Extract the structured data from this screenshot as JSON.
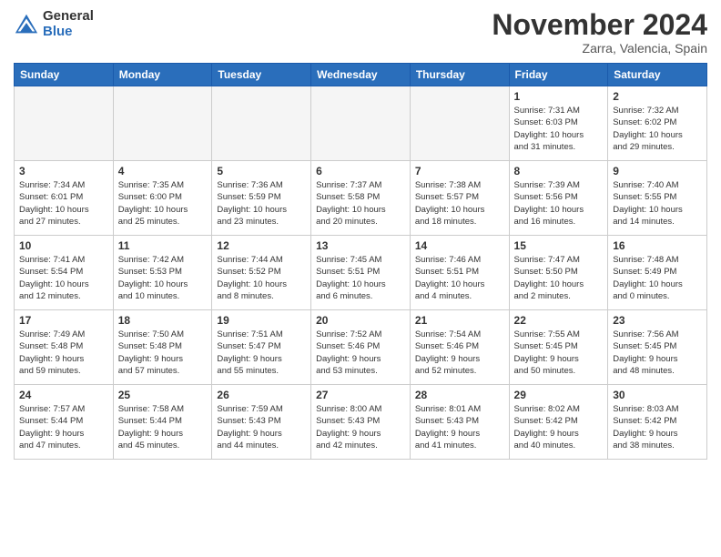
{
  "app": {
    "logo_general": "General",
    "logo_blue": "Blue"
  },
  "header": {
    "month_title": "November 2024",
    "location": "Zarra, Valencia, Spain"
  },
  "weekdays": [
    "Sunday",
    "Monday",
    "Tuesday",
    "Wednesday",
    "Thursday",
    "Friday",
    "Saturday"
  ],
  "weeks": [
    [
      {
        "day": "",
        "info": ""
      },
      {
        "day": "",
        "info": ""
      },
      {
        "day": "",
        "info": ""
      },
      {
        "day": "",
        "info": ""
      },
      {
        "day": "",
        "info": ""
      },
      {
        "day": "1",
        "info": "Sunrise: 7:31 AM\nSunset: 6:03 PM\nDaylight: 10 hours\nand 31 minutes."
      },
      {
        "day": "2",
        "info": "Sunrise: 7:32 AM\nSunset: 6:02 PM\nDaylight: 10 hours\nand 29 minutes."
      }
    ],
    [
      {
        "day": "3",
        "info": "Sunrise: 7:34 AM\nSunset: 6:01 PM\nDaylight: 10 hours\nand 27 minutes."
      },
      {
        "day": "4",
        "info": "Sunrise: 7:35 AM\nSunset: 6:00 PM\nDaylight: 10 hours\nand 25 minutes."
      },
      {
        "day": "5",
        "info": "Sunrise: 7:36 AM\nSunset: 5:59 PM\nDaylight: 10 hours\nand 23 minutes."
      },
      {
        "day": "6",
        "info": "Sunrise: 7:37 AM\nSunset: 5:58 PM\nDaylight: 10 hours\nand 20 minutes."
      },
      {
        "day": "7",
        "info": "Sunrise: 7:38 AM\nSunset: 5:57 PM\nDaylight: 10 hours\nand 18 minutes."
      },
      {
        "day": "8",
        "info": "Sunrise: 7:39 AM\nSunset: 5:56 PM\nDaylight: 10 hours\nand 16 minutes."
      },
      {
        "day": "9",
        "info": "Sunrise: 7:40 AM\nSunset: 5:55 PM\nDaylight: 10 hours\nand 14 minutes."
      }
    ],
    [
      {
        "day": "10",
        "info": "Sunrise: 7:41 AM\nSunset: 5:54 PM\nDaylight: 10 hours\nand 12 minutes."
      },
      {
        "day": "11",
        "info": "Sunrise: 7:42 AM\nSunset: 5:53 PM\nDaylight: 10 hours\nand 10 minutes."
      },
      {
        "day": "12",
        "info": "Sunrise: 7:44 AM\nSunset: 5:52 PM\nDaylight: 10 hours\nand 8 minutes."
      },
      {
        "day": "13",
        "info": "Sunrise: 7:45 AM\nSunset: 5:51 PM\nDaylight: 10 hours\nand 6 minutes."
      },
      {
        "day": "14",
        "info": "Sunrise: 7:46 AM\nSunset: 5:51 PM\nDaylight: 10 hours\nand 4 minutes."
      },
      {
        "day": "15",
        "info": "Sunrise: 7:47 AM\nSunset: 5:50 PM\nDaylight: 10 hours\nand 2 minutes."
      },
      {
        "day": "16",
        "info": "Sunrise: 7:48 AM\nSunset: 5:49 PM\nDaylight: 10 hours\nand 0 minutes."
      }
    ],
    [
      {
        "day": "17",
        "info": "Sunrise: 7:49 AM\nSunset: 5:48 PM\nDaylight: 9 hours\nand 59 minutes."
      },
      {
        "day": "18",
        "info": "Sunrise: 7:50 AM\nSunset: 5:48 PM\nDaylight: 9 hours\nand 57 minutes."
      },
      {
        "day": "19",
        "info": "Sunrise: 7:51 AM\nSunset: 5:47 PM\nDaylight: 9 hours\nand 55 minutes."
      },
      {
        "day": "20",
        "info": "Sunrise: 7:52 AM\nSunset: 5:46 PM\nDaylight: 9 hours\nand 53 minutes."
      },
      {
        "day": "21",
        "info": "Sunrise: 7:54 AM\nSunset: 5:46 PM\nDaylight: 9 hours\nand 52 minutes."
      },
      {
        "day": "22",
        "info": "Sunrise: 7:55 AM\nSunset: 5:45 PM\nDaylight: 9 hours\nand 50 minutes."
      },
      {
        "day": "23",
        "info": "Sunrise: 7:56 AM\nSunset: 5:45 PM\nDaylight: 9 hours\nand 48 minutes."
      }
    ],
    [
      {
        "day": "24",
        "info": "Sunrise: 7:57 AM\nSunset: 5:44 PM\nDaylight: 9 hours\nand 47 minutes."
      },
      {
        "day": "25",
        "info": "Sunrise: 7:58 AM\nSunset: 5:44 PM\nDaylight: 9 hours\nand 45 minutes."
      },
      {
        "day": "26",
        "info": "Sunrise: 7:59 AM\nSunset: 5:43 PM\nDaylight: 9 hours\nand 44 minutes."
      },
      {
        "day": "27",
        "info": "Sunrise: 8:00 AM\nSunset: 5:43 PM\nDaylight: 9 hours\nand 42 minutes."
      },
      {
        "day": "28",
        "info": "Sunrise: 8:01 AM\nSunset: 5:43 PM\nDaylight: 9 hours\nand 41 minutes."
      },
      {
        "day": "29",
        "info": "Sunrise: 8:02 AM\nSunset: 5:42 PM\nDaylight: 9 hours\nand 40 minutes."
      },
      {
        "day": "30",
        "info": "Sunrise: 8:03 AM\nSunset: 5:42 PM\nDaylight: 9 hours\nand 38 minutes."
      }
    ]
  ]
}
